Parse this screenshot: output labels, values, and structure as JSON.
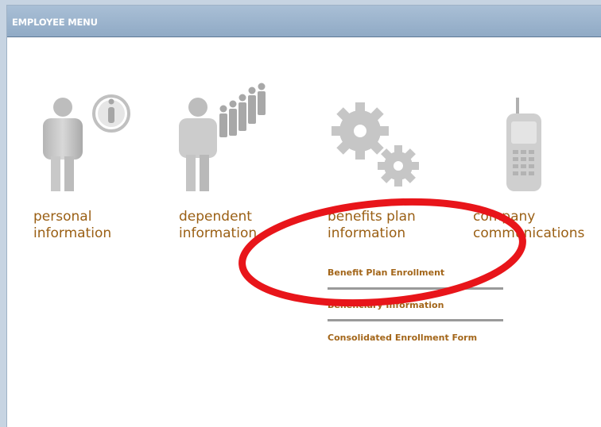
{
  "header": {
    "title": "EMPLOYEE MENU"
  },
  "menu_items": [
    {
      "line1": "personal",
      "line2": "information",
      "icon": "person-info-icon"
    },
    {
      "line1": "dependent",
      "line2": "information",
      "icon": "people-group-icon"
    },
    {
      "line1": "benefits plan",
      "line2": "information",
      "icon": "gears-icon"
    },
    {
      "line1": "company",
      "line2": "communications",
      "icon": "mobile-phone-icon"
    }
  ],
  "benefits_links": [
    "Benefit Plan Enrollment",
    "Beneficiary Information",
    "Consolidated Enrollment Form"
  ],
  "colors": {
    "header_bg": "#98b0cb",
    "label_text": "#9a5f14",
    "link_text": "#a3661a",
    "annotation_circle": "#e8151a"
  }
}
